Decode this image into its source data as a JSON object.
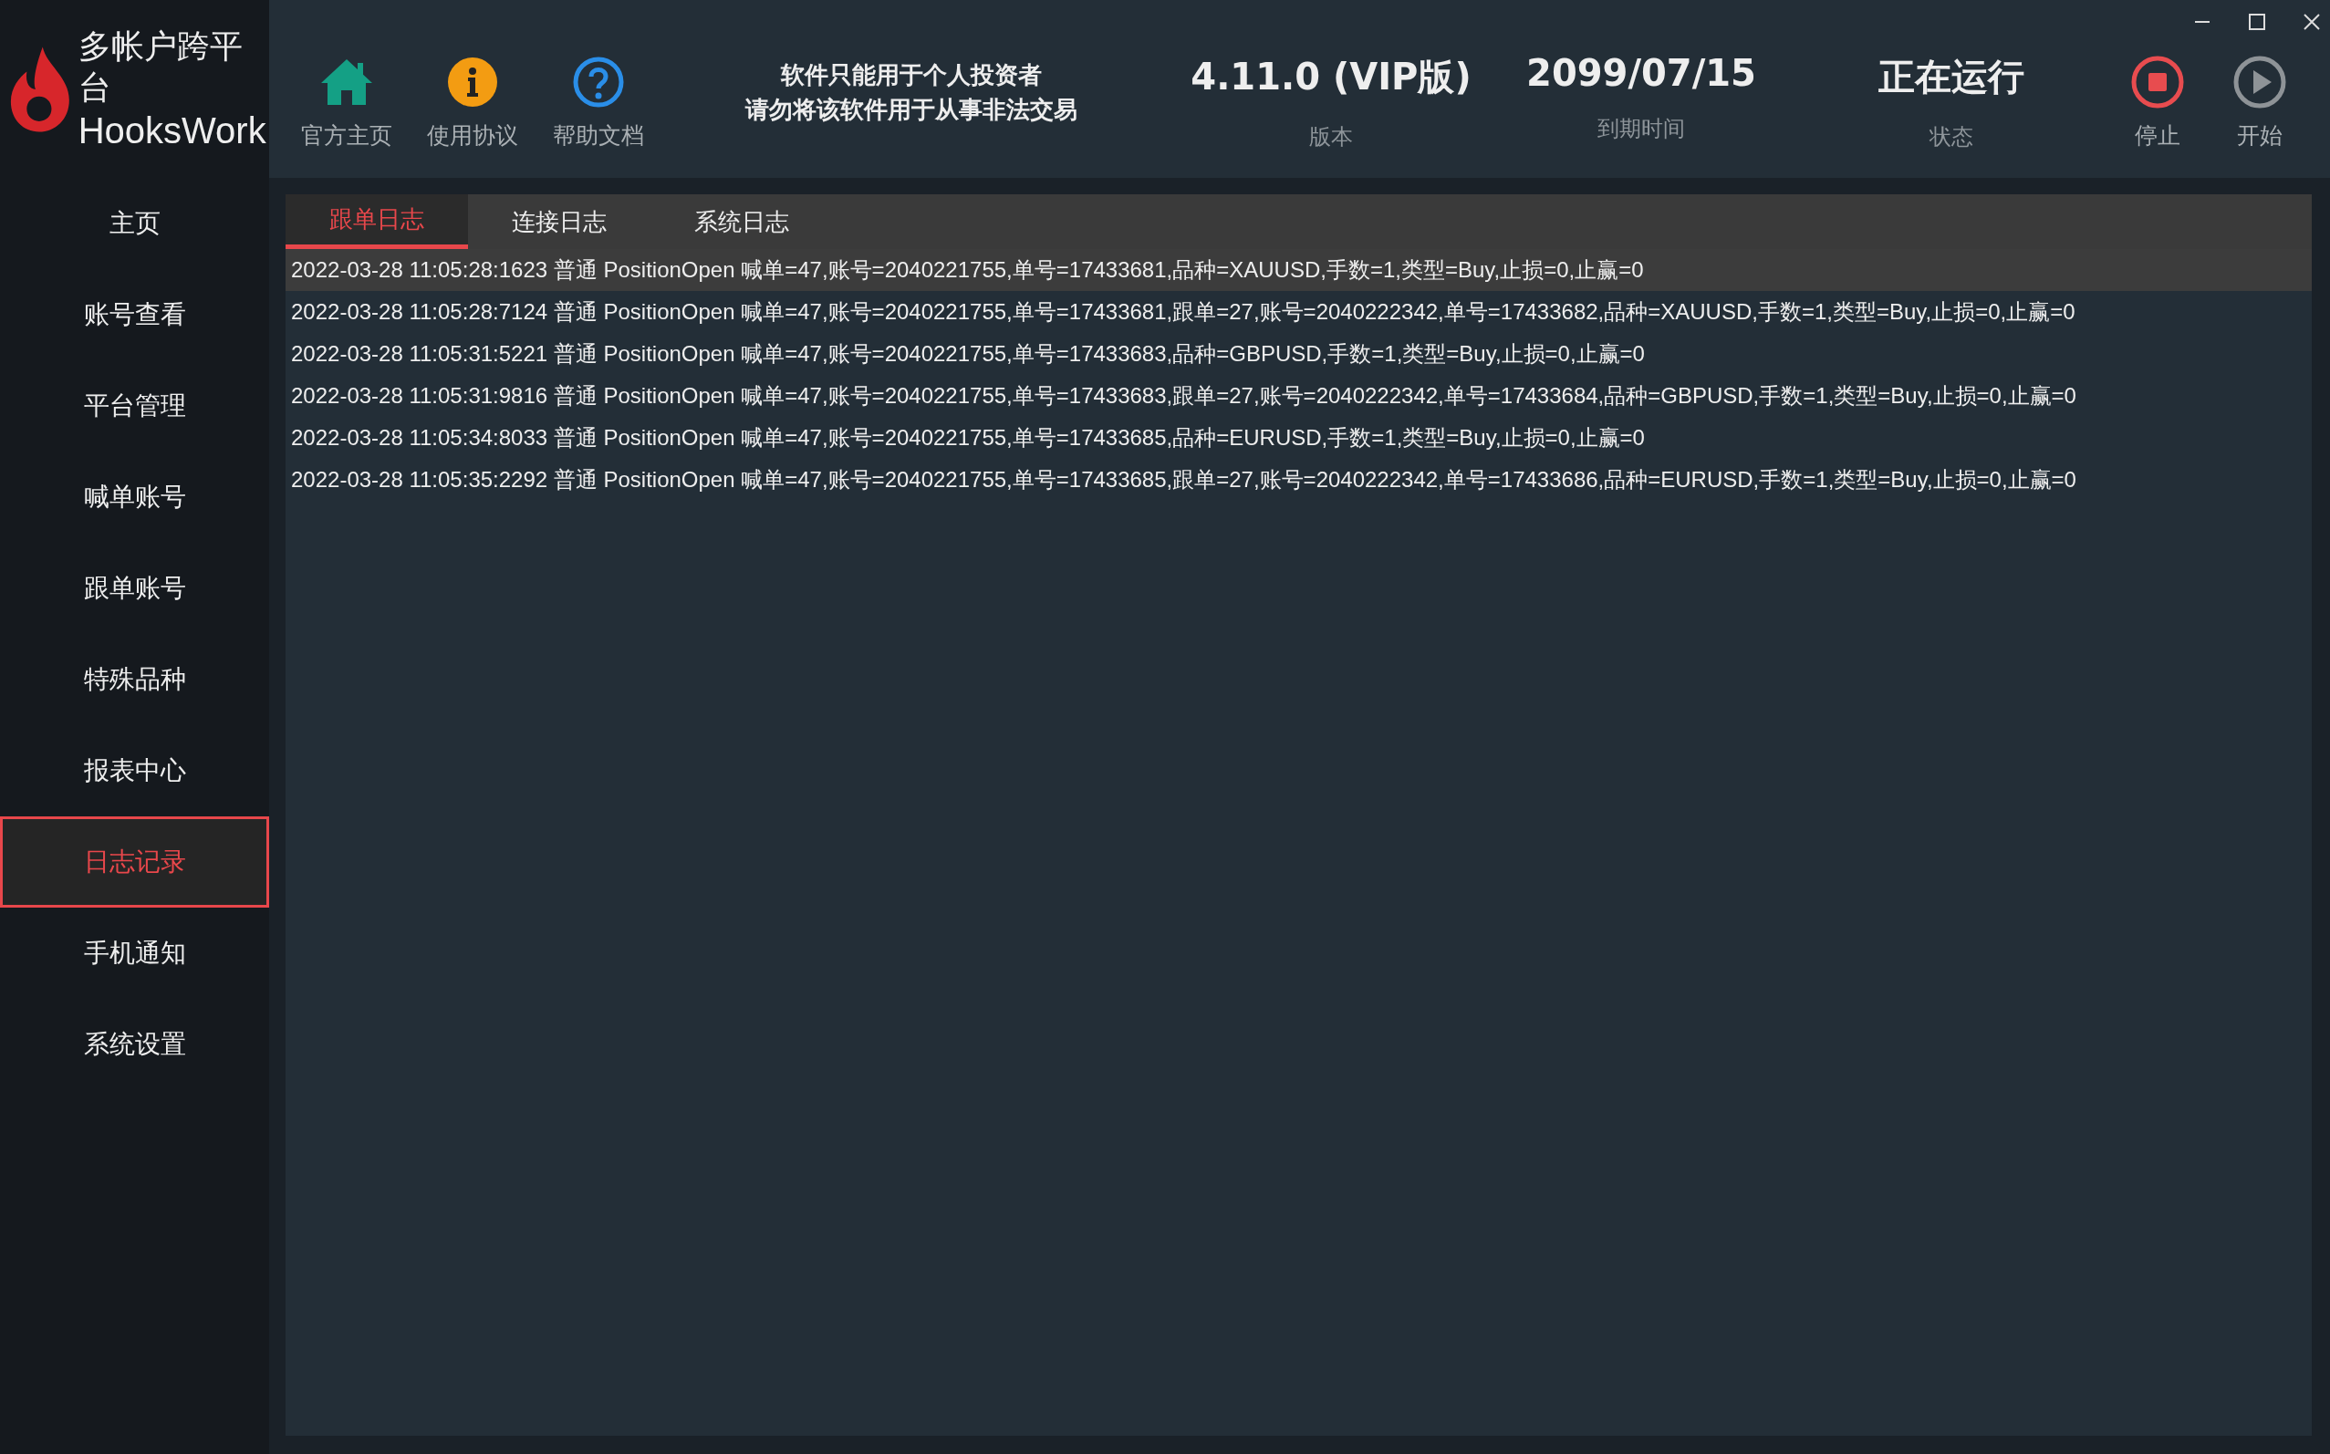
{
  "app": {
    "name": "多帐户跨平台",
    "brand": "HooksWork"
  },
  "toolbar": [
    {
      "kind": "home",
      "label": "官方主页"
    },
    {
      "kind": "info",
      "label": "使用协议"
    },
    {
      "kind": "help",
      "label": "帮助文档"
    }
  ],
  "notice": [
    "软件只能用于个人投资者",
    "请勿将该软件用于从事非法交易"
  ],
  "info": [
    {
      "value": "4.11.0 (VIP版)",
      "label": "版本"
    },
    {
      "value": "2099/07/15",
      "label": "到期时间"
    },
    {
      "value": "正在运行",
      "label": "状态"
    }
  ],
  "controls": [
    {
      "kind": "stop",
      "label": "停止",
      "active": true
    },
    {
      "kind": "play",
      "label": "开始",
      "active": false
    }
  ],
  "sidebar": {
    "items": [
      {
        "label": "主页",
        "selected": false
      },
      {
        "label": "账号查看",
        "selected": false
      },
      {
        "label": "平台管理",
        "selected": false
      },
      {
        "label": "喊单账号",
        "selected": false
      },
      {
        "label": "跟单账号",
        "selected": false
      },
      {
        "label": "特殊品种",
        "selected": false
      },
      {
        "label": "报表中心",
        "selected": false
      },
      {
        "label": "日志记录",
        "selected": true
      },
      {
        "label": "手机通知",
        "selected": false
      },
      {
        "label": "系统设置",
        "selected": false
      }
    ]
  },
  "tabs": [
    {
      "label": "跟单日志",
      "selected": true
    },
    {
      "label": "连接日志",
      "selected": false
    },
    {
      "label": "系统日志",
      "selected": false
    }
  ],
  "log": [
    {
      "text": "2022-03-28 11:05:28:1623 普通 PositionOpen 喊单=47,账号=2040221755,单号=17433681,品种=XAUUSD,手数=1,类型=Buy,止损=0,止赢=0",
      "selected": true
    },
    {
      "text": "2022-03-28 11:05:28:7124 普通 PositionOpen 喊单=47,账号=2040221755,单号=17433681,跟单=27,账号=2040222342,单号=17433682,品种=XAUUSD,手数=1,类型=Buy,止损=0,止赢=0",
      "selected": false
    },
    {
      "text": "2022-03-28 11:05:31:5221 普通 PositionOpen 喊单=47,账号=2040221755,单号=17433683,品种=GBPUSD,手数=1,类型=Buy,止损=0,止赢=0",
      "selected": false
    },
    {
      "text": "2022-03-28 11:05:31:9816 普通 PositionOpen 喊单=47,账号=2040221755,单号=17433683,跟单=27,账号=2040222342,单号=17433684,品种=GBPUSD,手数=1,类型=Buy,止损=0,止赢=0",
      "selected": false
    },
    {
      "text": "2022-03-28 11:05:34:8033 普通 PositionOpen 喊单=47,账号=2040221755,单号=17433685,品种=EURUSD,手数=1,类型=Buy,止损=0,止赢=0",
      "selected": false
    },
    {
      "text": "2022-03-28 11:05:35:2292 普通 PositionOpen 喊单=47,账号=2040221755,单号=17433685,跟单=27,账号=2040222342,单号=17433686,品种=EURUSD,手数=1,类型=Buy,止损=0,止赢=0",
      "selected": false
    }
  ]
}
